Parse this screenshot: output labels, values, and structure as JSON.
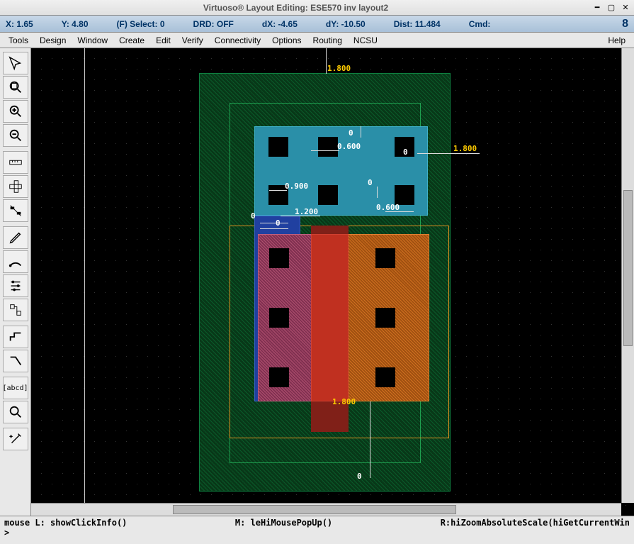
{
  "title": "Virtuoso® Layout Editing: ESE570 inv layout2",
  "status": {
    "x": "X: 1.65",
    "y": "Y: 4.80",
    "select": "(F) Select: 0",
    "drd": "DRD: OFF",
    "dx": "dX: -4.65",
    "dy": "dY: -10.50",
    "dist": "Dist: 11.484",
    "cmd": "Cmd:",
    "num": "8"
  },
  "menu": [
    "Tools",
    "Design",
    "Window",
    "Create",
    "Edit",
    "Verify",
    "Connectivity",
    "Options",
    "Routing",
    "NCSU",
    "Help"
  ],
  "tools": [
    "select",
    "zoom-fit",
    "zoom-in",
    "zoom-out",
    "ruler-h",
    "ruler-v",
    "align",
    "pencil",
    "arc",
    "props",
    "hier",
    "step",
    "path",
    "text",
    "zoom",
    "wand"
  ],
  "dimensions": {
    "top": "1.800",
    "right": "1.800",
    "bottom": "1.800",
    "d1": "0.600",
    "d2": "0.900",
    "d3": "1.200",
    "d4": "0.600",
    "z0": "0",
    "z1": "0",
    "z2": "0",
    "z3": "0",
    "z4": "0",
    "z5": "0",
    "z6": "0"
  },
  "footer": {
    "left": "mouse L: showClickInfo()",
    "mid": "M: leHiMousePopUp()",
    "right": "R:hiZoomAbsoluteScale(hiGetCurrentWin",
    "prompt": ">"
  }
}
